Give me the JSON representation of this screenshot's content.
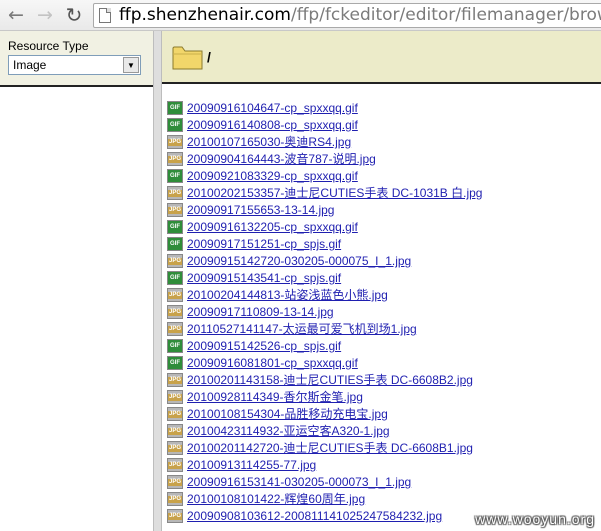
{
  "browser": {
    "url_host": "ffp.shenzhenair.com",
    "url_path": "/ffp/fckeditor/editor/filemanager/browser/",
    "nav_back_glyph": "←",
    "nav_forward_glyph": "→",
    "nav_reload_glyph": "↻"
  },
  "resource_panel": {
    "label": "Resource Type",
    "selected": "Image",
    "arrow_glyph": "▼"
  },
  "path_bar": {
    "path": "/",
    "folder_color": "#f2d66a"
  },
  "colors": {
    "path_bar_bg": "#ecebc9",
    "resource_bg": "#f1f1e3",
    "link": "#1f1fb0",
    "gif_icon": "#2f8d3a"
  },
  "files": [
    {
      "name": "20090916104647-cp_spxxqq.gif",
      "type": "gif"
    },
    {
      "name": "20090916140808-cp_spxxqq.gif",
      "type": "gif"
    },
    {
      "name": "20100107165030-奥迪RS4.jpg",
      "type": "jpg"
    },
    {
      "name": "20090904164443-波音787-说明.jpg",
      "type": "jpg"
    },
    {
      "name": "20090921083329-cp_spxxqq.gif",
      "type": "gif"
    },
    {
      "name": "20100202153357-迪士尼CUTIES手表 DC-1031B 白.jpg",
      "type": "jpg"
    },
    {
      "name": "20090917155653-13-14.jpg",
      "type": "jpg"
    },
    {
      "name": "20090916132205-cp_spxxqq.gif",
      "type": "gif"
    },
    {
      "name": "20090917151251-cp_spjs.gif",
      "type": "gif"
    },
    {
      "name": "20090915142720-030205-000075_I_1.jpg",
      "type": "jpg"
    },
    {
      "name": "20090915143541-cp_spjs.gif",
      "type": "gif"
    },
    {
      "name": "20100204144813-站姿浅蓝色小熊.jpg",
      "type": "jpg"
    },
    {
      "name": "20090917110809-13-14.jpg",
      "type": "jpg"
    },
    {
      "name": "20110527141147-太运最可爱飞机到场1.jpg",
      "type": "jpg"
    },
    {
      "name": "20090915142526-cp_spjs.gif",
      "type": "gif"
    },
    {
      "name": "20090916081801-cp_spxxqq.gif",
      "type": "gif"
    },
    {
      "name": "20100201143158-迪士尼CUTIES手表 DC-6608B2.jpg",
      "type": "jpg"
    },
    {
      "name": "20100928114349-香尔斯金笔.jpg",
      "type": "jpg"
    },
    {
      "name": "20100108154304-品胜移动充电宝.jpg",
      "type": "jpg"
    },
    {
      "name": "20100423114932-亚运空客A320-1.jpg",
      "type": "jpg"
    },
    {
      "name": "20100201142720-迪士尼CUTIES手表 DC-6608B1.jpg",
      "type": "jpg"
    },
    {
      "name": "20100913114255-77.jpg",
      "type": "jpg"
    },
    {
      "name": "20090916153141-030205-000073_I_1.jpg",
      "type": "jpg"
    },
    {
      "name": "20100108101422-辉煌60周年.jpg",
      "type": "jpg"
    },
    {
      "name": "20090908103612-20081114102524758423​2.jpg",
      "type": "jpg"
    }
  ],
  "watermark": "www.wooyun.org"
}
